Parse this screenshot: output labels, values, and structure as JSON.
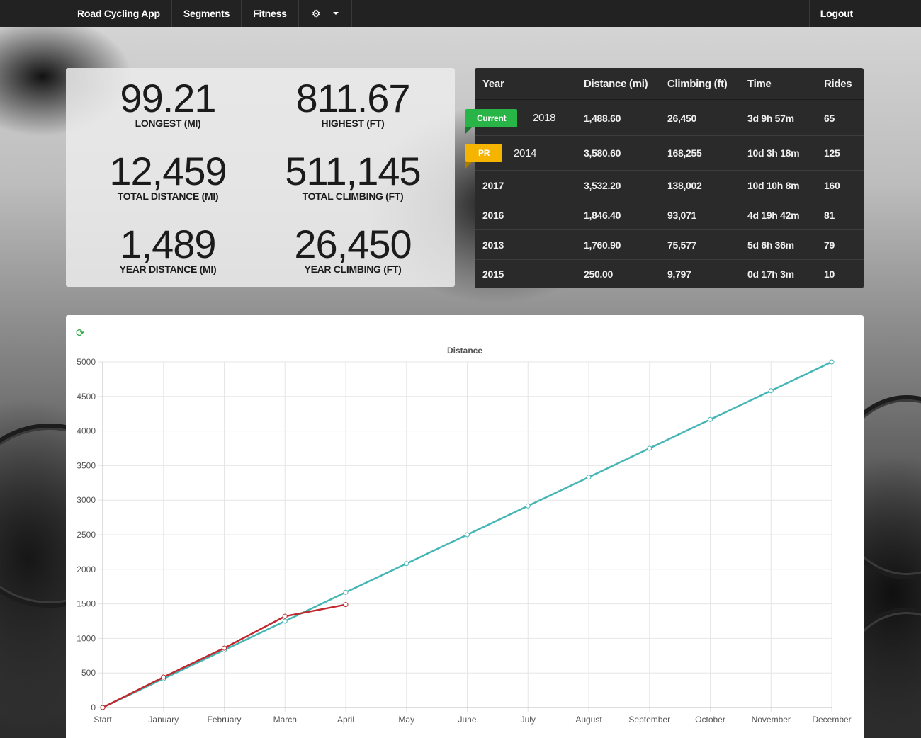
{
  "navbar": {
    "brand": "Road Cycling App",
    "items": [
      {
        "label": "Segments"
      },
      {
        "label": "Fitness"
      }
    ],
    "gear_icon": "gear-icon",
    "logout": "Logout"
  },
  "stats": {
    "longest": {
      "value": "99.21",
      "label": "LONGEST (MI)"
    },
    "highest": {
      "value": "811.67",
      "label": "HIGHEST (FT)"
    },
    "total_distance": {
      "value": "12,459",
      "label": "TOTAL DISTANCE (MI)"
    },
    "total_climbing": {
      "value": "511,145",
      "label": "TOTAL CLIMBING (FT)"
    },
    "year_distance": {
      "value": "1,489",
      "label": "YEAR DISTANCE (MI)"
    },
    "year_climbing": {
      "value": "26,450",
      "label": "YEAR CLIMBING (FT)"
    }
  },
  "years_table": {
    "headers": [
      "Year",
      "Distance (mi)",
      "Climbing (ft)",
      "Time",
      "Rides"
    ],
    "rows": [
      {
        "badge": "Current",
        "badge_color": "#28b446",
        "year": "2018",
        "distance": "1,488.60",
        "climbing": "26,450",
        "time": "3d 9h 57m",
        "rides": "65"
      },
      {
        "badge": "PR",
        "badge_color": "#f5b400",
        "year": "2014",
        "distance": "3,580.60",
        "climbing": "168,255",
        "time": "10d 3h 18m",
        "rides": "125"
      },
      {
        "badge": "",
        "year": "2017",
        "distance": "3,532.20",
        "climbing": "138,002",
        "time": "10d 10h 8m",
        "rides": "160"
      },
      {
        "badge": "",
        "year": "2016",
        "distance": "1,846.40",
        "climbing": "93,071",
        "time": "4d 19h 42m",
        "rides": "81"
      },
      {
        "badge": "",
        "year": "2013",
        "distance": "1,760.90",
        "climbing": "75,577",
        "time": "5d 6h 36m",
        "rides": "79"
      },
      {
        "badge": "",
        "year": "2015",
        "distance": "250.00",
        "climbing": "9,797",
        "time": "0d 17h 3m",
        "rides": "10"
      }
    ]
  },
  "chart_data": {
    "type": "line",
    "title": "Distance",
    "xlabel": "",
    "ylabel": "",
    "categories": [
      "Start",
      "January",
      "February",
      "March",
      "April",
      "May",
      "June",
      "July",
      "August",
      "September",
      "October",
      "November",
      "December"
    ],
    "ylim": [
      0,
      5000
    ],
    "yticks": [
      0,
      500,
      1000,
      1500,
      2000,
      2500,
      3000,
      3500,
      4000,
      4500,
      5000
    ],
    "grid": true,
    "series": [
      {
        "color": "#45b5b5",
        "values": [
          0,
          417,
          833,
          1250,
          1667,
          2083,
          2500,
          2917,
          3333,
          3750,
          4167,
          4583,
          5000
        ]
      },
      {
        "color": "#c1272d",
        "values": [
          0,
          440,
          860,
          1320,
          1489
        ]
      }
    ]
  }
}
